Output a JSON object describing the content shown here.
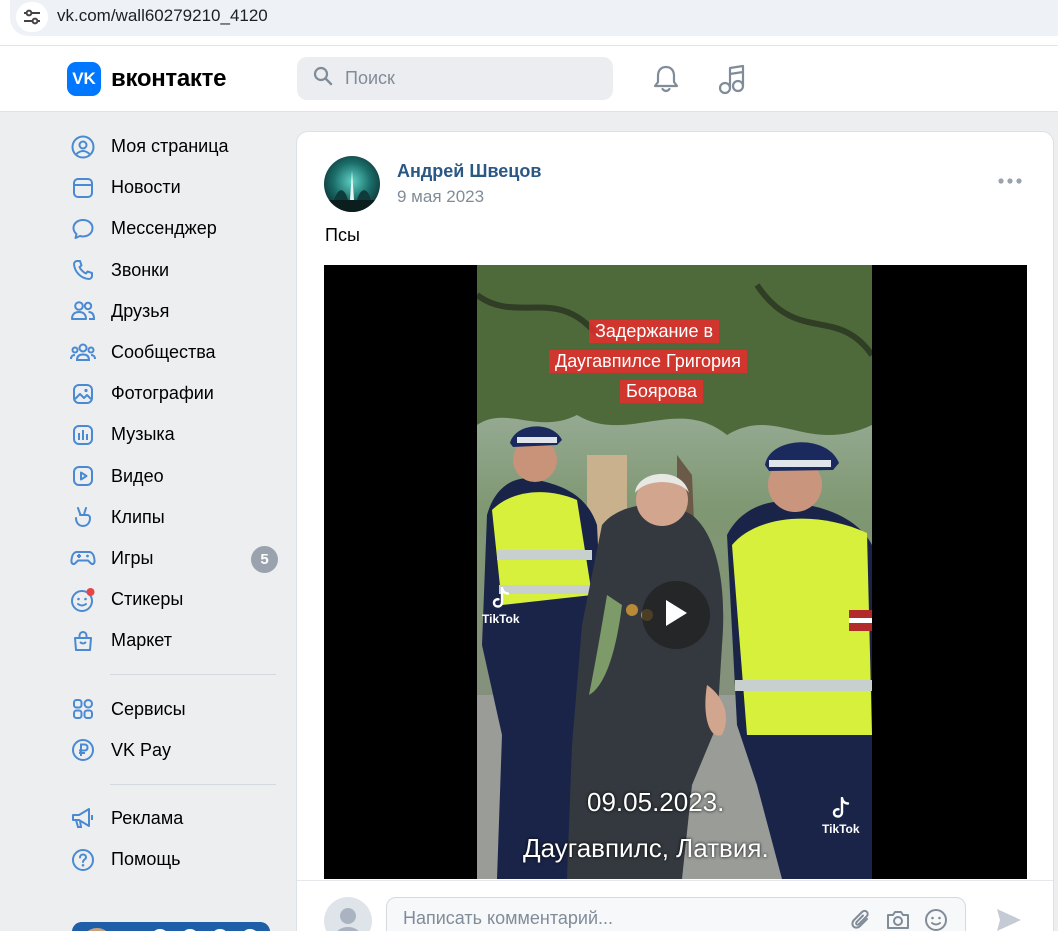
{
  "browser": {
    "url": "vk.com/wall60279210_4120"
  },
  "header": {
    "logo_mark": "VK",
    "logo_text": "вконтакте",
    "search_placeholder": "Поиск"
  },
  "sidebar": {
    "items": [
      {
        "label": "Моя страница",
        "icon": "user-circle-icon"
      },
      {
        "label": "Новости",
        "icon": "news-icon"
      },
      {
        "label": "Мессенджер",
        "icon": "message-icon"
      },
      {
        "label": "Звонки",
        "icon": "phone-icon"
      },
      {
        "label": "Друзья",
        "icon": "friends-icon"
      },
      {
        "label": "Сообщества",
        "icon": "communities-icon"
      },
      {
        "label": "Фотографии",
        "icon": "photo-icon"
      },
      {
        "label": "Музыка",
        "icon": "music-icon"
      },
      {
        "label": "Видео",
        "icon": "video-icon"
      },
      {
        "label": "Клипы",
        "icon": "clips-icon"
      },
      {
        "label": "Игры",
        "icon": "games-icon",
        "badge": "5"
      },
      {
        "label": "Стикеры",
        "icon": "sticker-icon"
      },
      {
        "label": "Маркет",
        "icon": "market-icon"
      }
    ],
    "services": [
      {
        "label": "Сервисы",
        "icon": "services-icon"
      },
      {
        "label": "VK Pay",
        "icon": "vkpay-icon"
      }
    ],
    "extra": [
      {
        "label": "Реклама",
        "icon": "megaphone-icon"
      },
      {
        "label": "Помощь",
        "icon": "help-icon"
      }
    ]
  },
  "post": {
    "author": "Андрей Швецов",
    "date": "9 мая 2023",
    "text": "Псы",
    "video": {
      "overlay_title": [
        "Задержание в",
        "Даугавпилсе Григория",
        "Боярова"
      ],
      "overlay_date": "09.05.2023.",
      "overlay_place": "Даугавпилс, Латвия.",
      "watermark": "TikTok"
    }
  },
  "comment": {
    "placeholder": "Написать комментарий..."
  },
  "colors": {
    "accent": "#0077ff",
    "link": "#2a5885",
    "muted": "#818c99",
    "badge": "#99a2ad"
  }
}
